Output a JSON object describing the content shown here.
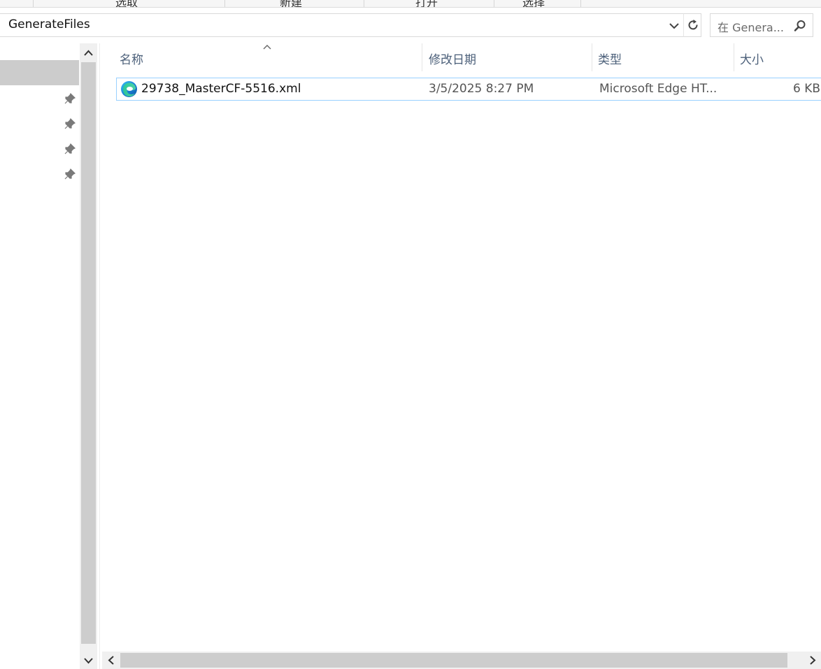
{
  "ribbon": {
    "tabs": [
      "选取",
      "新建",
      "打开",
      "选择"
    ]
  },
  "address": {
    "path": "GenerateFiles"
  },
  "search": {
    "placeholder": "在 Genera..."
  },
  "columns": {
    "name": "名称",
    "date": "修改日期",
    "type": "类型",
    "size": "大小"
  },
  "files": [
    {
      "name": "29738_MasterCF-5516.xml",
      "modified": "3/5/2025 8:27 PM",
      "type": "Microsoft Edge HT...",
      "size": "6 KB",
      "icon": "edge-icon"
    }
  ],
  "icons": {
    "dropdown": "chevron-down-icon",
    "refresh": "refresh-icon",
    "search": "search-icon",
    "pin": "pin-icon"
  },
  "colors": {
    "selection_border": "#99d1ff",
    "header_text": "#4c607a",
    "nav_selected": "#cccccc"
  }
}
